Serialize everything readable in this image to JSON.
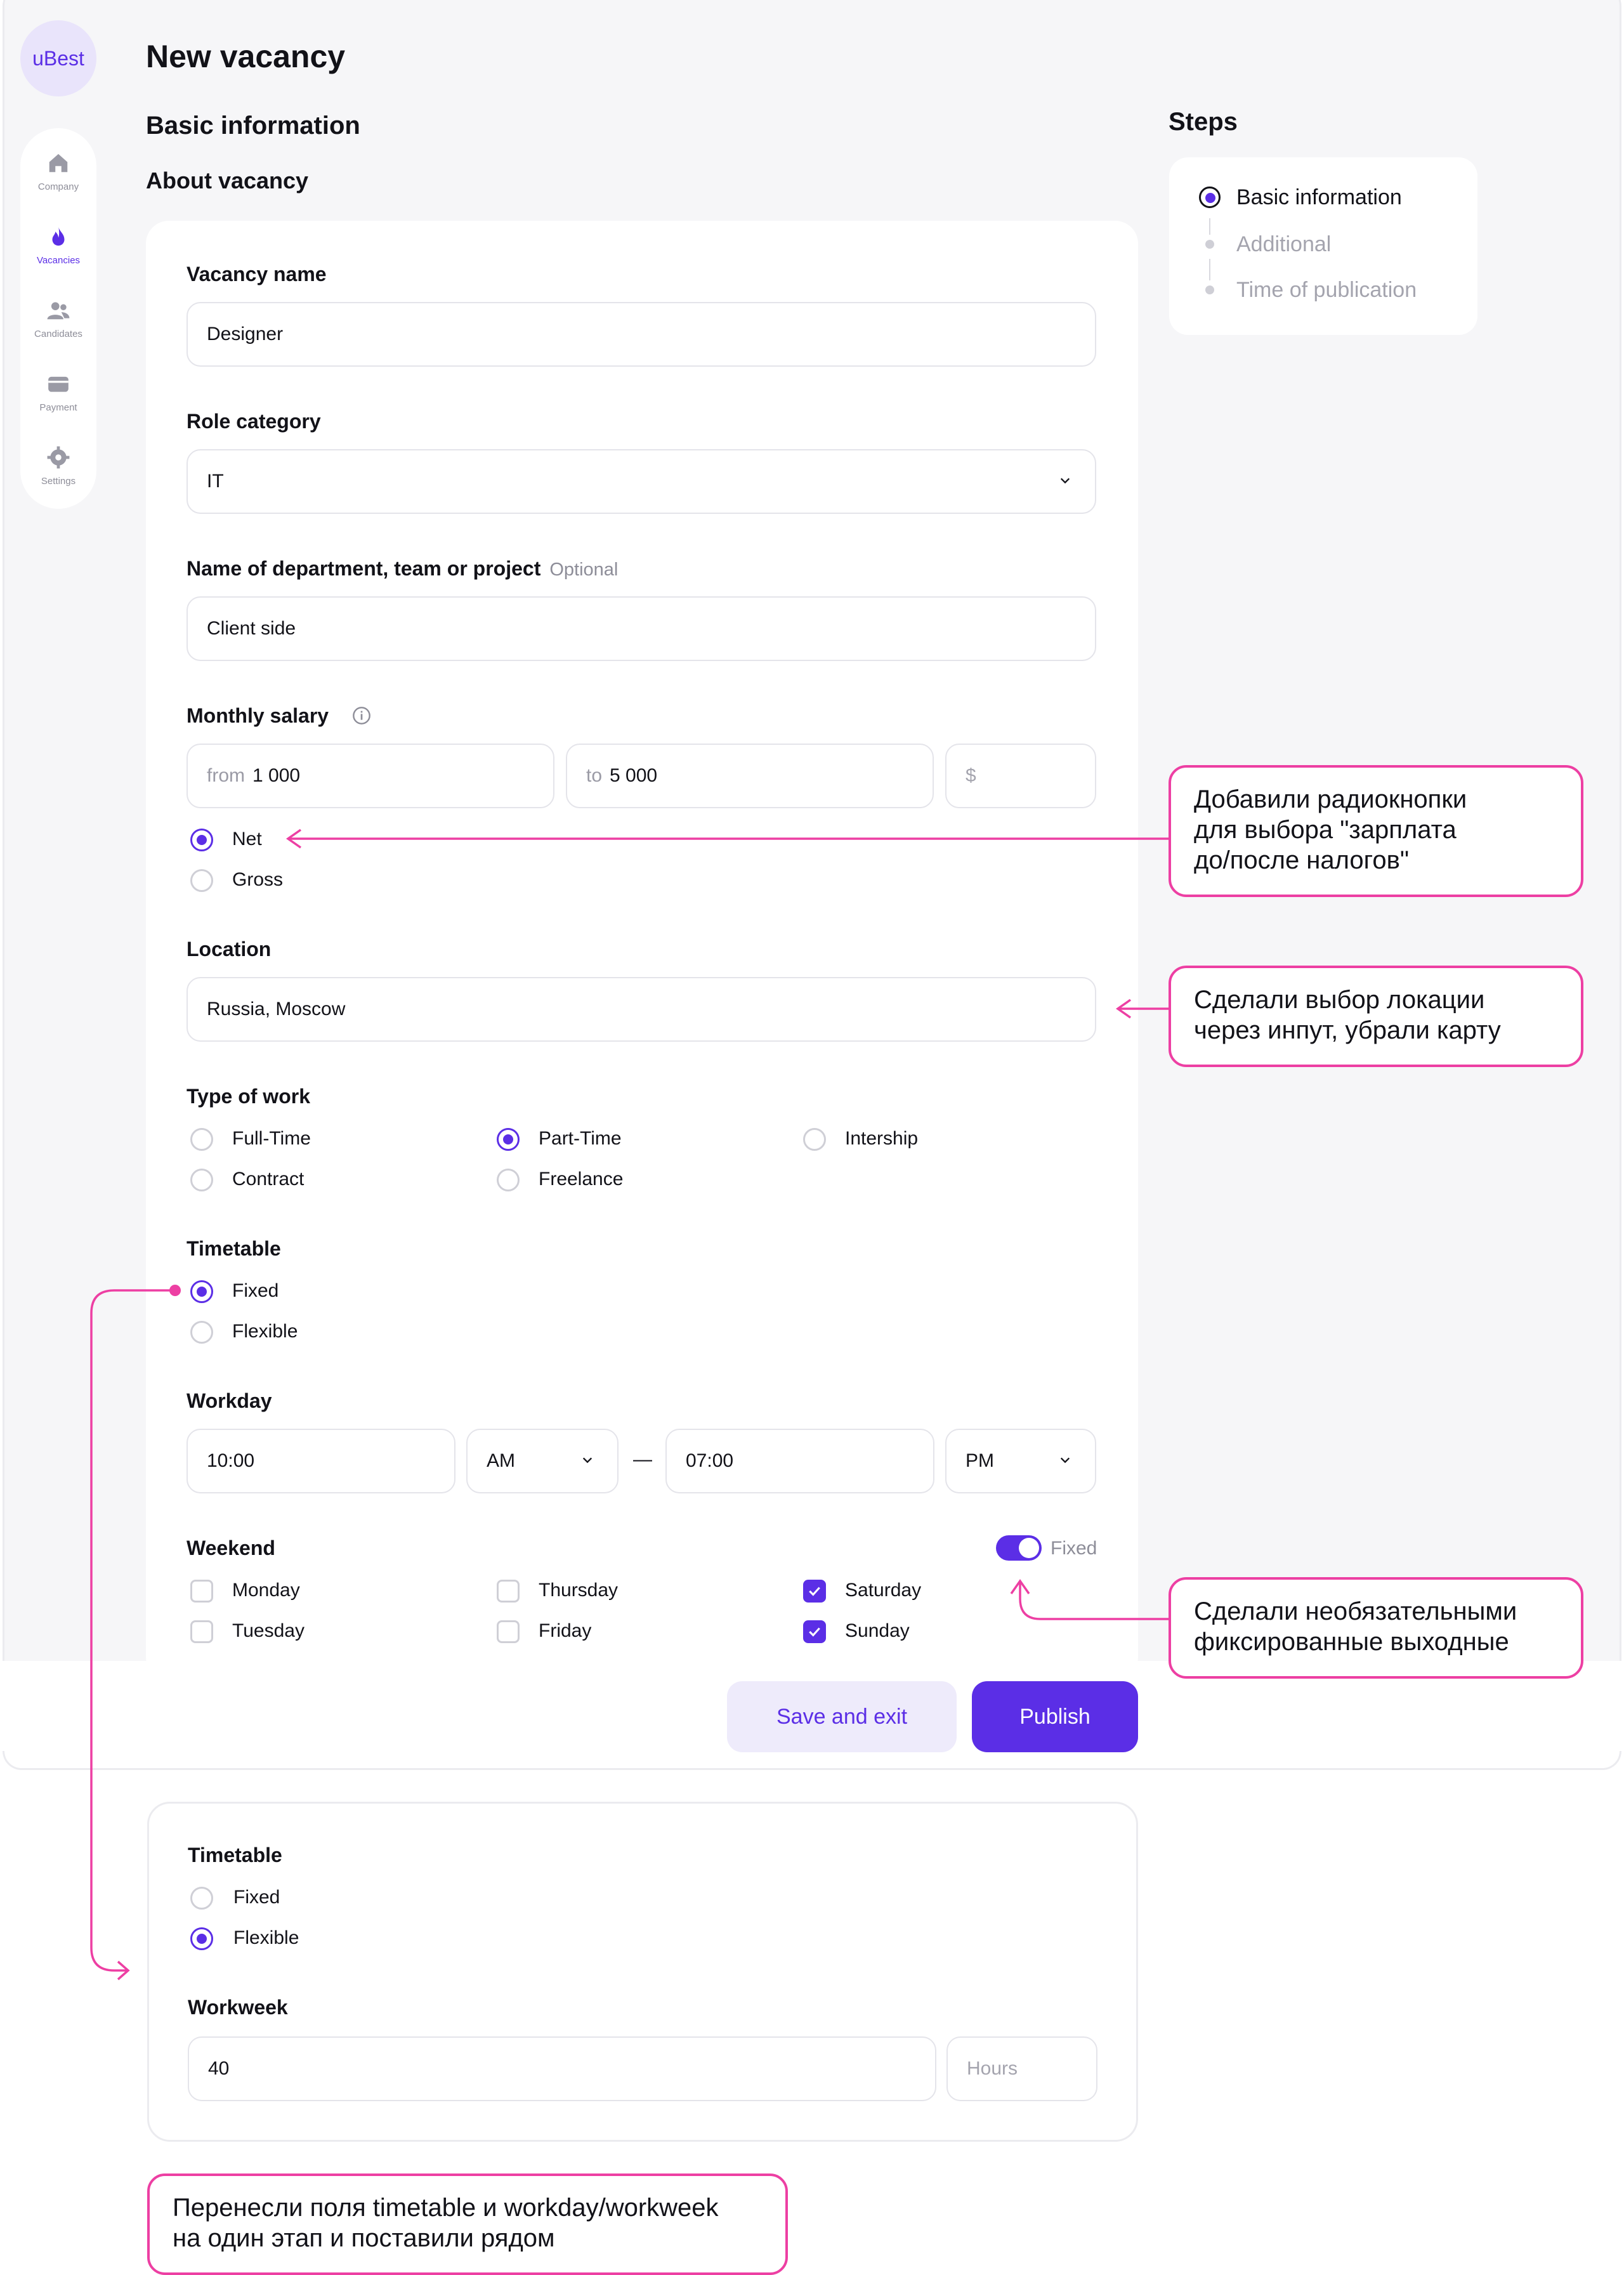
{
  "app": {
    "logo_text": "uBest"
  },
  "sidebar": {
    "items": [
      {
        "label": "Company",
        "icon": "home-icon",
        "active": false
      },
      {
        "label": "Vacancies",
        "icon": "flame-icon",
        "active": true
      },
      {
        "label": "Candidates",
        "icon": "users-icon",
        "active": false
      },
      {
        "label": "Payment",
        "icon": "wallet-icon",
        "active": false
      },
      {
        "label": "Settings",
        "icon": "gear-icon",
        "active": false
      }
    ]
  },
  "page": {
    "title": "New vacancy",
    "section_title": "Basic information",
    "subsection_title": "About vacancy"
  },
  "form": {
    "vacancy_name": {
      "label": "Vacancy name",
      "value": "Designer"
    },
    "role_category": {
      "label": "Role category",
      "value": "IT"
    },
    "department": {
      "label": "Name of department, team or project",
      "optional": "Optional",
      "value": "Client side"
    },
    "salary": {
      "label": "Monthly salary",
      "from_prefix": "from",
      "from_value": "1 000",
      "to_prefix": "to",
      "to_value": "5 000",
      "currency_placeholder": "$",
      "options": [
        "Net",
        "Gross"
      ],
      "selected": "Net"
    },
    "location": {
      "label": "Location",
      "value": "Russia, Moscow"
    },
    "type_of_work": {
      "label": "Type of work",
      "options": [
        "Full-Time",
        "Part-Time",
        "Intership",
        "Contract",
        "Freelance"
      ],
      "selected": "Part-Time"
    },
    "timetable": {
      "label": "Timetable",
      "options": [
        "Fixed",
        "Flexible"
      ],
      "selected": "Fixed"
    },
    "workday": {
      "label": "Workday",
      "from_time": "10:00",
      "from_period": "AM",
      "separator": "—",
      "to_time": "07:00",
      "to_period": "PM"
    },
    "weekend": {
      "label": "Weekend",
      "toggle_label": "Fixed",
      "toggle_on": true,
      "days": [
        {
          "name": "Monday",
          "checked": false
        },
        {
          "name": "Thursday",
          "checked": false
        },
        {
          "name": "Saturday",
          "checked": true
        },
        {
          "name": "Tuesday",
          "checked": false
        },
        {
          "name": "Friday",
          "checked": false
        },
        {
          "name": "Sunday",
          "checked": true
        }
      ]
    }
  },
  "actions": {
    "save_label": "Save and exit",
    "publish_label": "Publish"
  },
  "steps": {
    "title": "Steps",
    "items": [
      {
        "label": "Basic information",
        "state": "current"
      },
      {
        "label": "Additional",
        "state": "upcoming"
      },
      {
        "label": "Time of publication",
        "state": "upcoming"
      }
    ]
  },
  "alt_card": {
    "timetable_label": "Timetable",
    "options": [
      "Fixed",
      "Flexible"
    ],
    "selected": "Flexible",
    "workweek_label": "Workweek",
    "workweek_value": "40",
    "hours_placeholder": "Hours"
  },
  "annotations": {
    "salary_note": [
      "Добавили радиокнопки",
      "для выбора \"зарплата",
      "до/после налогов\""
    ],
    "location_note": [
      "Сделали выбор локации",
      "через инпут, убрали карту"
    ],
    "weekend_note": [
      "Сделали необязательными",
      "фиксированные выходные"
    ],
    "timetable_note": [
      "Перенесли поля timetable и workday/workweek",
      "на один этап и поставили рядом"
    ]
  },
  "colors": {
    "accent": "#5b2ee6",
    "annotation": "#ed3fa3",
    "background": "#f6f6f8"
  }
}
